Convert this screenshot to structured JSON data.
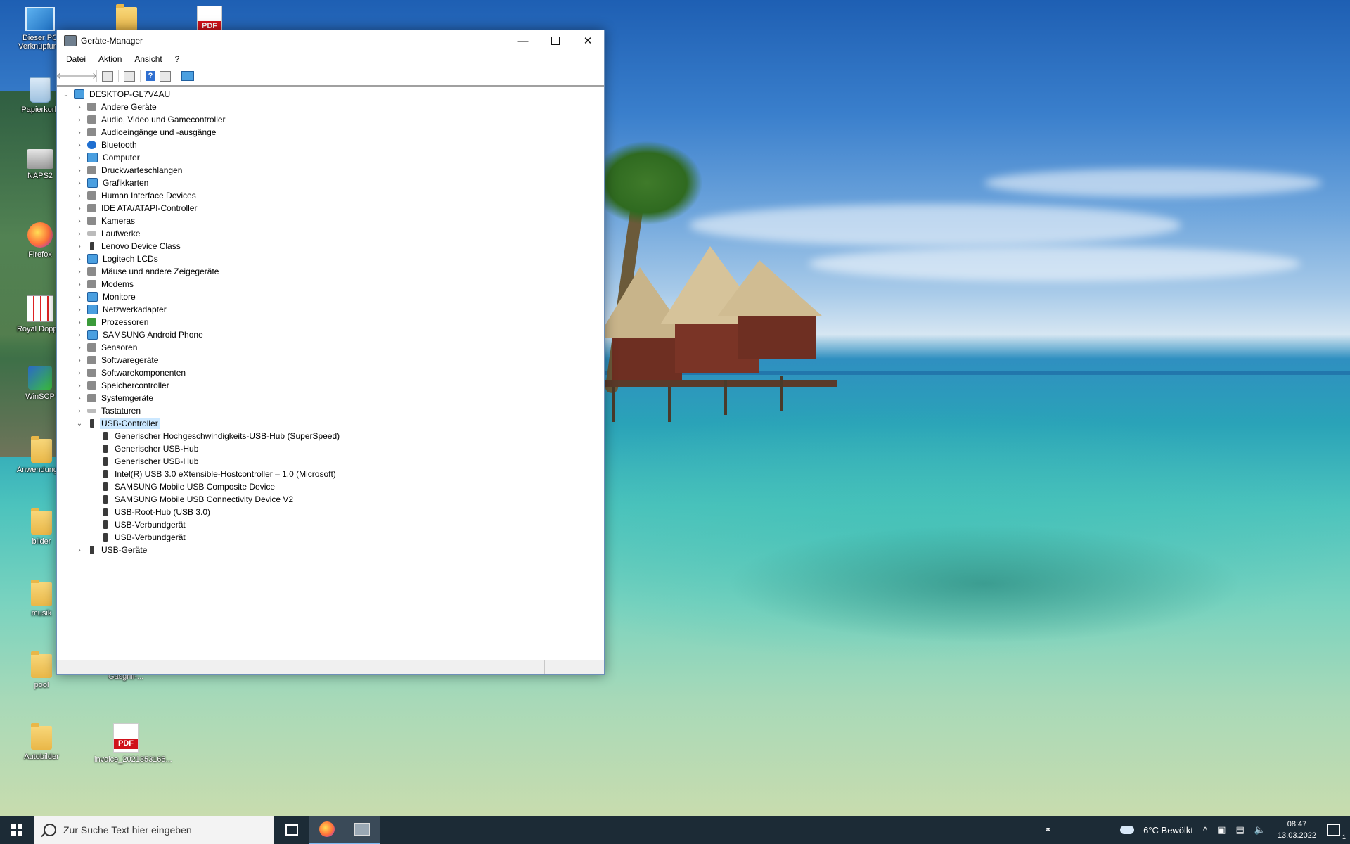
{
  "desktop": {
    "icons": [
      {
        "label": "Dieser PC Verknüpfung",
        "type": "pc"
      },
      {
        "label": "Papierkorb",
        "type": "bin"
      },
      {
        "label": "NAPS2",
        "type": "scanner"
      },
      {
        "label": "Firefox",
        "type": "firefox"
      },
      {
        "label": "Royal Doppel",
        "type": "cards"
      },
      {
        "label": "WinSCP",
        "type": "winscp"
      },
      {
        "label": "Anwendungen",
        "type": "folder"
      },
      {
        "label": "bilder",
        "type": "folder"
      },
      {
        "label": "musik",
        "type": "folder"
      },
      {
        "label": "pool",
        "type": "folder"
      },
      {
        "label": "Autobilder",
        "type": "folder"
      },
      {
        "label": "",
        "type": "folder"
      },
      {
        "label": "PDF",
        "type": "pdf"
      },
      {
        "label": "Grillfuerst-Gasgrill-...",
        "type": "pdf"
      },
      {
        "label": "invoice_2021353165...",
        "type": "pdf"
      }
    ],
    "pdf_badge": "PDF"
  },
  "window": {
    "title": "Geräte-Manager",
    "controls": {
      "minimize": "—",
      "close": "✕"
    },
    "menu": [
      "Datei",
      "Aktion",
      "Ansicht",
      "?"
    ],
    "toolbar": {
      "back": "🡐",
      "forward": "🡒",
      "help": "?"
    },
    "tree": {
      "root": "DESKTOP-GL7V4AU",
      "categories": [
        {
          "label": "Andere Geräte",
          "icon": "unknown-device-icon"
        },
        {
          "label": "Audio, Video und Gamecontroller",
          "icon": "speaker-icon"
        },
        {
          "label": "Audioeingänge und -ausgänge",
          "icon": "speaker-icon"
        },
        {
          "label": "Bluetooth",
          "icon": "bluetooth-icon"
        },
        {
          "label": "Computer",
          "icon": "computer-icon"
        },
        {
          "label": "Druckwarteschlangen",
          "icon": "printer-icon"
        },
        {
          "label": "Grafikkarten",
          "icon": "display-adapter-icon"
        },
        {
          "label": "Human Interface Devices",
          "icon": "hid-icon"
        },
        {
          "label": "IDE ATA/ATAPI-Controller",
          "icon": "ide-icon"
        },
        {
          "label": "Kameras",
          "icon": "camera-icon"
        },
        {
          "label": "Laufwerke",
          "icon": "drive-icon"
        },
        {
          "label": "Lenovo Device Class",
          "icon": "usb-plug-icon"
        },
        {
          "label": "Logitech LCDs",
          "icon": "monitor-icon"
        },
        {
          "label": "Mäuse und andere Zeigegeräte",
          "icon": "mouse-icon"
        },
        {
          "label": "Modems",
          "icon": "modem-icon"
        },
        {
          "label": "Monitore",
          "icon": "monitor-icon"
        },
        {
          "label": "Netzwerkadapter",
          "icon": "network-icon"
        },
        {
          "label": "Prozessoren",
          "icon": "processor-icon"
        },
        {
          "label": "SAMSUNG Android Phone",
          "icon": "phone-icon"
        },
        {
          "label": "Sensoren",
          "icon": "sensor-icon"
        },
        {
          "label": "Softwaregeräte",
          "icon": "software-device-icon"
        },
        {
          "label": "Softwarekomponenten",
          "icon": "software-component-icon"
        },
        {
          "label": "Speichercontroller",
          "icon": "storage-controller-icon"
        },
        {
          "label": "Systemgeräte",
          "icon": "system-device-icon"
        },
        {
          "label": "Tastaturen",
          "icon": "keyboard-icon"
        }
      ],
      "usb_controller": {
        "label": "USB-Controller",
        "children": [
          "Generischer Hochgeschwindigkeits-USB-Hub (SuperSpeed)",
          "Generischer USB-Hub",
          "Generischer USB-Hub",
          "Intel(R) USB 3.0 eXtensible-Hostcontroller – 1.0 (Microsoft)",
          "SAMSUNG Mobile USB Composite Device",
          "SAMSUNG Mobile USB Connectivity Device V2",
          "USB-Root-Hub (USB 3.0)",
          "USB-Verbundgerät",
          "USB-Verbundgerät"
        ]
      },
      "usb_devices": "USB-Geräte"
    }
  },
  "taskbar": {
    "search_placeholder": "Zur Suche Text hier eingeben",
    "weather": "6°C  Bewölkt",
    "time": "08:47",
    "date": "13.03.2022",
    "notification_count": "1",
    "tray_chevron": "^",
    "volume_icon": "🔈"
  }
}
